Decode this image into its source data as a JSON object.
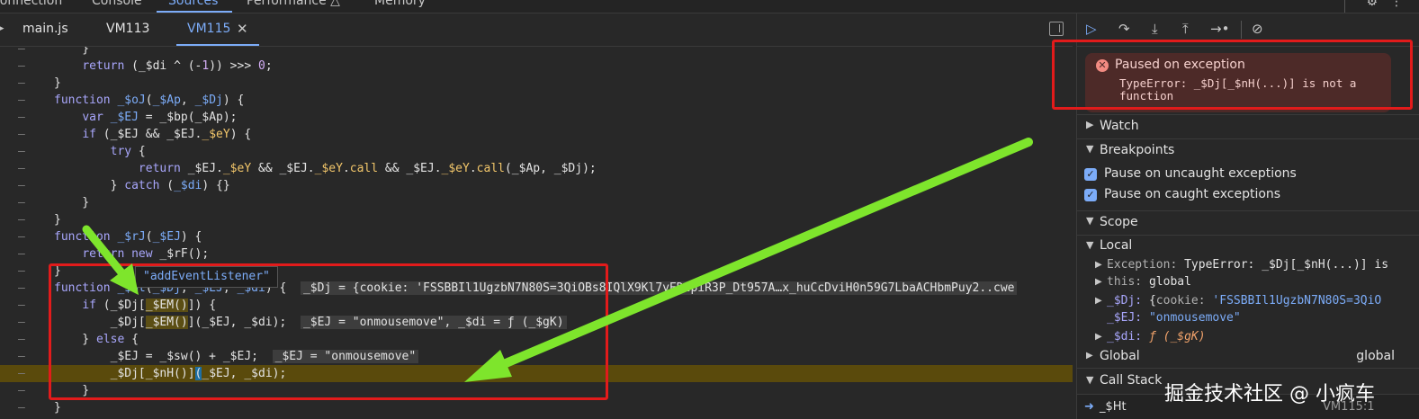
{
  "topbar": {
    "tabs": [
      "Connection",
      "Console",
      "Sources",
      "Performance △",
      "Memory"
    ],
    "active_tab": "Sources"
  },
  "file_tabs": [
    "main.js",
    "VM113",
    "VM115"
  ],
  "active_file": "VM115",
  "code_lines": [
    {
      "gut": "–",
      "html": "    }"
    },
    {
      "gut": "–",
      "html": "    <span class=\"kw\">return</span> (_$di ^ (-<span class=\"num\">1</span>)) &gt;&gt;&gt; <span class=\"num\">0</span>;"
    },
    {
      "gut": "–",
      "html": "}"
    },
    {
      "gut": "–",
      "html": "<span class=\"kw\">function</span> <span class=\"fn\">_$oJ</span>(<span class=\"pm\">_$Ap</span>, <span class=\"pm\">_$Dj</span>) {"
    },
    {
      "gut": "–",
      "html": "    <span class=\"kw\">var</span> <span class=\"pm\">_$EJ</span> = _$bp(_$Ap);"
    },
    {
      "gut": "–",
      "html": "    <span class=\"kw\">if</span> (_$EJ &amp;&amp; _$EJ.<span class=\"prop\">_$eY</span>) {"
    },
    {
      "gut": "–",
      "html": "        <span class=\"kw\">try</span> {"
    },
    {
      "gut": "–",
      "html": "            <span class=\"kw\">return</span> _$EJ.<span class=\"prop\">_$eY</span> &amp;&amp; _$EJ.<span class=\"prop\">_$eY</span>.<span class=\"prop\">call</span> &amp;&amp; _$EJ.<span class=\"prop\">_$eY</span>.<span class=\"prop\">call</span>(_$Ap, _$Dj);"
    },
    {
      "gut": "–",
      "html": "        } <span class=\"kw\">catch</span> (<span class=\"pm\">_$di</span>) {}"
    },
    {
      "gut": "–",
      "html": "    }"
    },
    {
      "gut": "–",
      "html": "}"
    },
    {
      "gut": "–",
      "html": "<span class=\"kw\">function</span> <span class=\"fn\">_$rJ</span>(<span class=\"pm\">_$EJ</span>) {"
    },
    {
      "gut": "–",
      "html": "    <span class=\"kw\">return</span> <span class=\"kw\">new</span> _$rF();"
    },
    {
      "gut": "–",
      "html": "}"
    },
    {
      "gut": "–",
      "html": "<span class=\"kw\">function</span> <span class=\"fn\">_$Ht</span>(<span class=\"pm\">_$Dj</span>, <span class=\"pm\">_$EJ</span>, <span class=\"pm\">_$di</span>) {  <span class=\"inl\">_$Dj = {cookie: 'FSSBBIl1UgzbN7N80S=3QiOBs8IQlX9Kl7yEDzpiR3P_Dt957A…x_huCcDviH0n59G7LbaACHbmPuy2..cwe</span>"
    },
    {
      "gut": "–",
      "html": "    <span class=\"kw\">if</span> (_$Dj[<span class=\"hi\">_$EM()</span>]) {"
    },
    {
      "gut": "–",
      "html": "        _$Dj[<span class=\"hi\">_$EM()</span>](_$EJ, _$di);  <span class=\"inl\">_$EJ = \"onmousemove\", _$di = ƒ (_$gK)</span>"
    },
    {
      "gut": "–",
      "html": "    } <span class=\"kw\">else</span> {"
    },
    {
      "gut": "–",
      "html": "        _$EJ = _$sw() + _$EJ;  <span class=\"inl\">_$EJ = \"onmousemove\"</span>"
    },
    {
      "gut": "–",
      "html": "        _$Dj[_$nH()]<span class=\"paren\">(</span>_$EJ, _$di);",
      "hl": true
    },
    {
      "gut": "–",
      "html": "    }"
    },
    {
      "gut": "–",
      "html": "}"
    }
  ],
  "tooltip": "\"addEventListener\"",
  "debugger": {
    "exception_title": "Paused on exception",
    "exception_message": "TypeError: _$Dj[_$nH(...)] is not a function",
    "watch_label": "Watch",
    "breakpoints_label": "Breakpoints",
    "pause_uncaught": "Pause on uncaught exceptions",
    "pause_caught": "Pause on caught exceptions",
    "scope_label": "Scope",
    "local_label": "Local",
    "exception_key": "Exception:",
    "exception_value": "TypeError: _$Dj[_$nH(...)] is",
    "this_key": "this:",
    "this_value": "global",
    "dj_key": "_$Dj:",
    "dj_brace": "{",
    "dj_inner_key": "cookie:",
    "dj_inner_value": "'FSSBBIl1UgzbN7N80S=3QiO",
    "ej_key": "_$EJ:",
    "ej_value": "\"onmousemove\"",
    "di_key": "_$di:",
    "di_value": "ƒ (_$gK)",
    "global_label": "Global",
    "global_value": "global",
    "callstack_label": "Call Stack",
    "frame_name": "_$Ht",
    "frame_location": "VM115:1"
  },
  "watermark": "掘金技术社区 @ 小疯车",
  "colors": {
    "annotation_red": "#e21b1b",
    "annotation_green": "#7ee52c",
    "accent_blue": "#7cacf8"
  }
}
